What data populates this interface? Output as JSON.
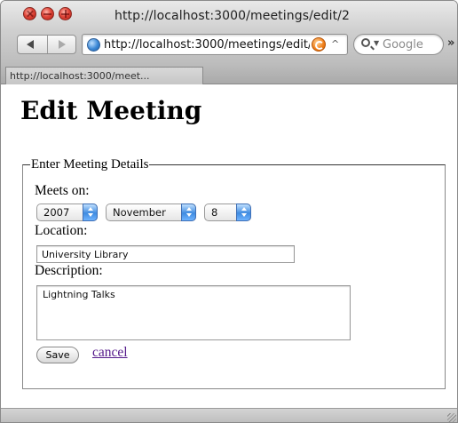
{
  "window": {
    "title": "http://localhost:3000/meetings/edit/2"
  },
  "toolbar": {
    "url": "http://localhost:3000/meetings/edit/2",
    "search_placeholder": "Google",
    "overflow": "»"
  },
  "tab": {
    "label": "http://localhost:3000/meet..."
  },
  "page": {
    "title": "Edit Meeting",
    "fieldset_legend": "Enter Meeting Details",
    "meets_on_label": "Meets on:",
    "year": "2007",
    "month": "November",
    "day": "8",
    "location_label": "Location:",
    "location_value": "University Library",
    "description_label": "Description:",
    "description_value": "Lightning Talks",
    "save_label": "Save",
    "cancel_label": "cancel"
  },
  "icons": {
    "close": "close-icon",
    "minimize": "minimize-icon",
    "zoom": "zoom-icon",
    "back": "back-arrow-icon",
    "forward": "forward-arrow-icon",
    "site": "globe-icon",
    "snapback": "snapback-icon",
    "search": "search-icon"
  },
  "colors": {
    "link_visited": "#551a8b",
    "select_arrow": "#3f8be0"
  }
}
